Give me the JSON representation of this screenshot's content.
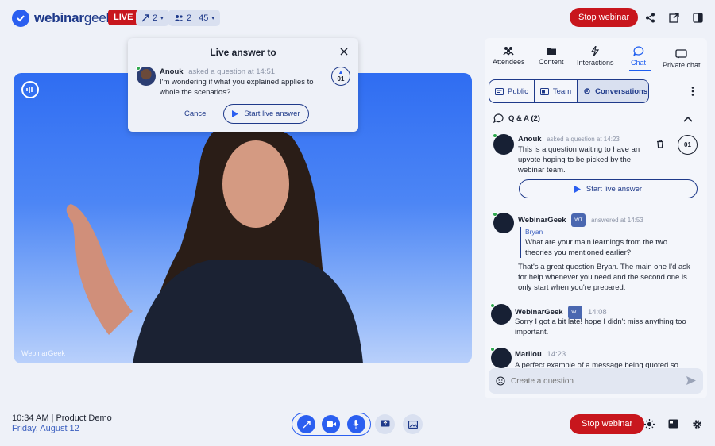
{
  "brand": {
    "name_bold": "webinar",
    "name_regular": "geek"
  },
  "header": {
    "live_label": "LIVE",
    "hosts_count": "2",
    "attendees_count": "2 | 45",
    "stop_label": "Stop webinar"
  },
  "video": {
    "watermark": "WebinarGeek"
  },
  "popup": {
    "title": "Live answer to",
    "asker": "Anouk",
    "meta": "asked a question at 14:51",
    "question": "I'm wondering if what you explained applies to whole the scenarios?",
    "votes": "01",
    "cancel_label": "Cancel",
    "start_label": "Start live answer"
  },
  "panel": {
    "tabs": [
      {
        "label": "Attendees",
        "icon": "attendees-icon"
      },
      {
        "label": "Content",
        "icon": "folder-icon"
      },
      {
        "label": "Interactions",
        "icon": "lightning-icon"
      },
      {
        "label": "Chat",
        "icon": "chat-icon"
      },
      {
        "label": "Private chat",
        "icon": "private-chat-icon"
      }
    ],
    "segments": [
      {
        "label": "Public"
      },
      {
        "label": "Team"
      },
      {
        "label": "Conversations"
      }
    ],
    "qa_title": "Q & A (2)",
    "question": {
      "author": "Anouk",
      "meta": "asked a question at 14:23",
      "text": "This is a question waiting to have an upvote hoping to be picked by the webinar team.",
      "votes": "01",
      "start_label": "Start live answer"
    },
    "answer": {
      "author": "WebinarGeek",
      "badge": "WT",
      "meta": "answered at 14:53",
      "quote_author": "Bryan",
      "quote_text": "What are your main learnings from the two theories you mentioned earlier?",
      "text": "That's a great question Bryan. The main one I'd ask for help whenever you need and the second one is only start when you're prepared."
    },
    "message2": {
      "author": "WebinarGeek",
      "badge": "WT",
      "time": "14:08",
      "text": "Sorry I got a bit late! hope I didn't miss anything too important."
    },
    "message3": {
      "author": "Marilou",
      "time": "14:23",
      "text": "A perfect example of a message being quoted so"
    },
    "composer_placeholder": "Create a question"
  },
  "footer": {
    "clock": "10:34 AM | Product Demo",
    "date": "Friday, August 12",
    "stop_label": "Stop webinar"
  },
  "colors": {
    "accent": "#2b5ff0",
    "danger": "#c8161d",
    "navy": "#1f3a8a",
    "background": "#eef1f8"
  }
}
